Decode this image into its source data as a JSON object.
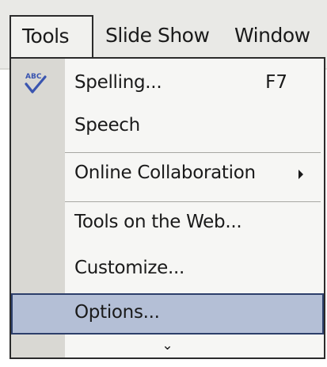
{
  "menubar": {
    "items": [
      {
        "label": "Tools"
      },
      {
        "label": "Slide Show"
      },
      {
        "label": "Window"
      }
    ]
  },
  "tools_menu": {
    "items": [
      {
        "label": "Spelling...",
        "shortcut": "F7",
        "icon": "spelling-check-icon"
      },
      {
        "label": "Speech"
      },
      {
        "label": "Online Collaboration",
        "submenu": true
      },
      {
        "label": "Tools on the Web..."
      },
      {
        "label": "Customize..."
      },
      {
        "label": "Options...",
        "highlighted": true
      }
    ],
    "expand_glyph": "⌄"
  },
  "colors": {
    "menubar_bg": "#e9e9e6",
    "menu_bg": "#f6f6f4",
    "gutter_bg": "#d9d8d3",
    "highlight_bg": "#b4bfd6",
    "highlight_border": "#2d3f6b",
    "icon_blue": "#3a55b0"
  }
}
